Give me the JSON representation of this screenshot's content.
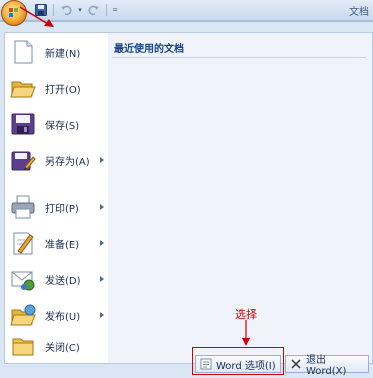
{
  "title_bar": {
    "title": "文档",
    "qat_dropdown_glyph": "="
  },
  "qat": [
    {
      "name": "save-icon"
    },
    {
      "name": "undo-icon"
    },
    {
      "name": "redo-icon"
    }
  ],
  "recent": {
    "header": "最近使用的文档"
  },
  "menu": {
    "items": [
      {
        "label": "新建(N)",
        "icon": "new-document-icon",
        "submenu": false
      },
      {
        "label": "打开(O)",
        "icon": "open-folder-icon",
        "submenu": false
      },
      {
        "label": "保存(S)",
        "icon": "save-disk-icon",
        "submenu": false
      },
      {
        "label": "另存为(A)",
        "icon": "save-as-icon",
        "submenu": true
      },
      {
        "label": "打印(P)",
        "icon": "printer-icon",
        "submenu": true
      },
      {
        "label": "准备(E)",
        "icon": "prepare-icon",
        "submenu": true
      },
      {
        "label": "发送(D)",
        "icon": "send-icon",
        "submenu": true
      },
      {
        "label": "发布(U)",
        "icon": "publish-icon",
        "submenu": true
      },
      {
        "label": "关闭(C)",
        "icon": "close-folder-icon",
        "submenu": false
      }
    ]
  },
  "bottom": {
    "word_options": "Word 选项(I)",
    "exit_word": "退出 Word(X)"
  },
  "annotation": {
    "select_text": "选择",
    "color": "#d10000"
  },
  "colors": {
    "panel_bg": "#dbe6f4",
    "menu_text": "#1a2c53",
    "header_text": "#15428b"
  }
}
